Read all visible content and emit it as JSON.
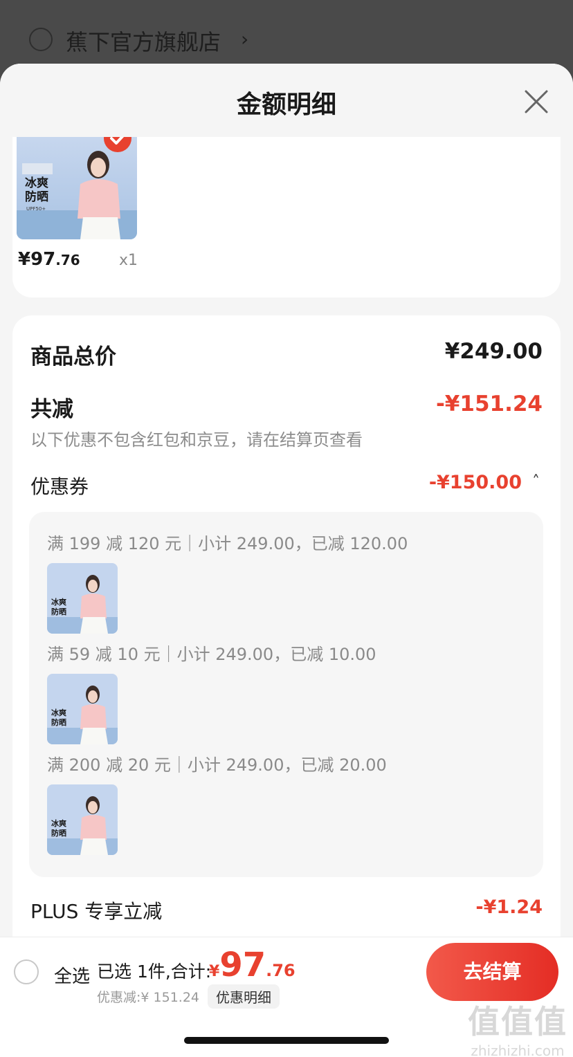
{
  "background": {
    "store_name": "蕉下官方旗舰店",
    "arrow": "›"
  },
  "sheet": {
    "title": "金额明细",
    "close_icon": "close-icon"
  },
  "product": {
    "image_text_1": "冰爽",
    "image_text_2": "防晒",
    "image_tag": "UPF50+",
    "price_currency": "¥",
    "price_int": "97",
    "price_dec": ".76",
    "quantity": "x1"
  },
  "detail": {
    "total_label": "商品总价",
    "total_value": "¥249.00",
    "reduce_label": "共减",
    "reduce_value": "-¥151.24",
    "note": "以下优惠不包含红包和京豆，请在结算页查看",
    "coupon_label": "优惠券",
    "coupon_value": "-¥150.00",
    "coupon_chevron": "˄",
    "coupons": [
      {
        "text": "满 199 减 120 元｜小计 249.00，已减 120.00"
      },
      {
        "text": "满 59 减 10 元｜小计 249.00，已减 10.00"
      },
      {
        "text": "满 200 减 20 元｜小计 249.00，已减 20.00"
      }
    ],
    "plus_label": "PLUS 专享立减",
    "plus_value": "-¥1.24"
  },
  "bottom_bar": {
    "select_all": "全选",
    "selected_text": "已选 1件,合计:",
    "total_currency": "¥",
    "total_int": "97",
    "total_dec": ".76",
    "saved_text": "优惠减:¥ 151.24",
    "detail_tag": "优惠明细",
    "checkout": "去结算"
  },
  "watermark": {
    "line1": "值值值",
    "line2": "zhizhizhi.com"
  },
  "colors": {
    "accent_red": "#e8412f",
    "sheet_bg": "#f5f5f5"
  }
}
